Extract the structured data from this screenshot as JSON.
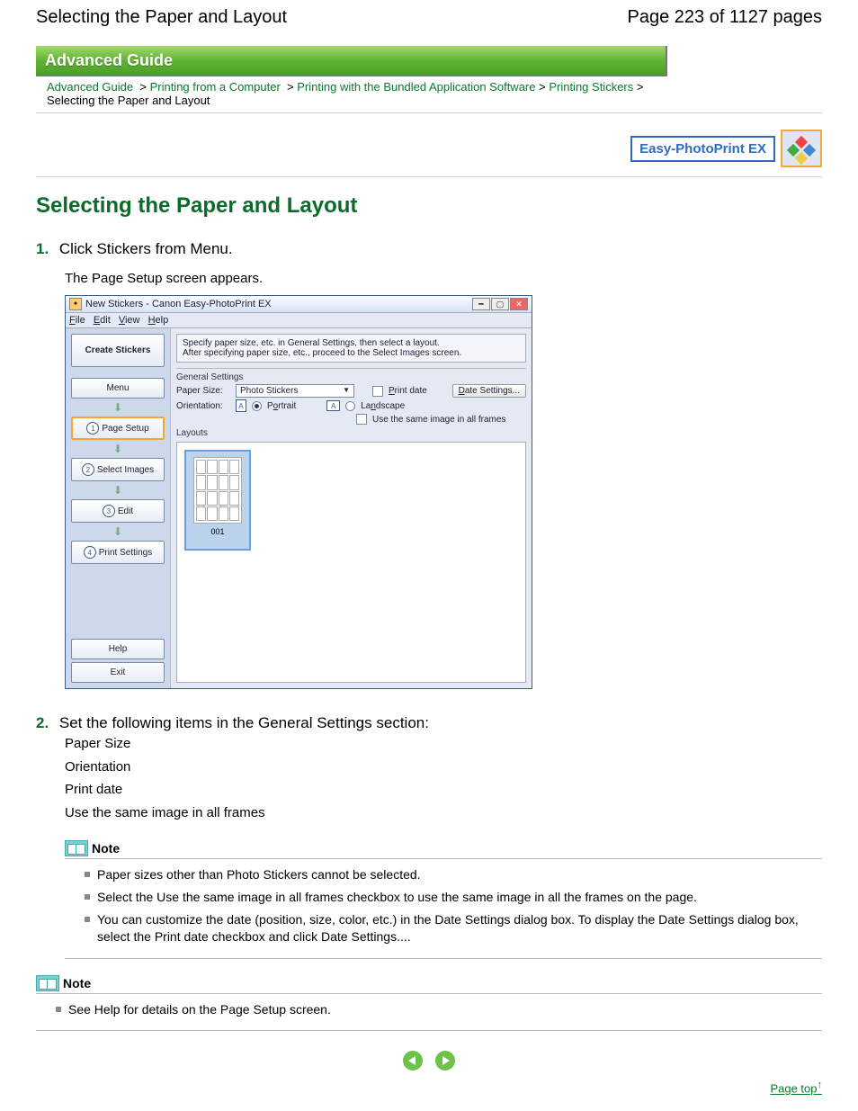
{
  "header": {
    "left": "Selecting the Paper and Layout",
    "right": "Page 223 of 1127 pages"
  },
  "banner": "Advanced Guide",
  "breadcrumb": {
    "items": [
      "Advanced Guide",
      "Printing from a Computer",
      "Printing with the Bundled Application Software",
      "Printing Stickers"
    ],
    "sep": ">",
    "current": "Selecting the Paper and Layout"
  },
  "product_label": "Easy-PhotoPrint EX",
  "title": "Selecting the Paper and Layout",
  "steps": {
    "s1": {
      "num": "1.",
      "text": "Click Stickers from Menu.",
      "sub": "The Page Setup screen appears."
    },
    "s2": {
      "num": "2.",
      "text": "Set the following items in the General Settings section:",
      "items": [
        "Paper Size",
        "Orientation",
        "Print date",
        "Use the same image in all frames"
      ]
    }
  },
  "app": {
    "title": "New Stickers - Canon Easy-PhotoPrint EX",
    "menubar": [
      "File",
      "Edit",
      "View",
      "Help"
    ],
    "sidebar": {
      "create": "Create Stickers",
      "menu": "Menu",
      "page_setup": "Page Setup",
      "select_images": "Select Images",
      "edit": "Edit",
      "print_settings": "Print Settings",
      "help": "Help",
      "exit": "Exit"
    },
    "desc1": "Specify paper size, etc. in General Settings, then select a layout.",
    "desc2": "After specifying paper size, etc., proceed to the Select Images screen.",
    "general_settings": "General Settings",
    "paper_size_label": "Paper Size:",
    "paper_size_value": "Photo Stickers",
    "orientation_label": "Orientation:",
    "portrait": "Portrait",
    "landscape": "Landscape",
    "print_date": "Print date",
    "date_settings_btn": "Date Settings...",
    "same_image": "Use the same image in all frames",
    "layouts": "Layouts",
    "thumb_label": "001"
  },
  "note_label": "Note",
  "notes1": [
    "Paper sizes other than Photo Stickers cannot be selected.",
    "Select the Use the same image in all frames checkbox to use the same image in all the frames on the page.",
    "You can customize the date (position, size, color, etc.) in the Date Settings dialog box. To display the Date Settings dialog box, select the Print date checkbox and click Date Settings...."
  ],
  "notes2": [
    "See Help for details on the Page Setup screen."
  ],
  "page_top": "Page top"
}
